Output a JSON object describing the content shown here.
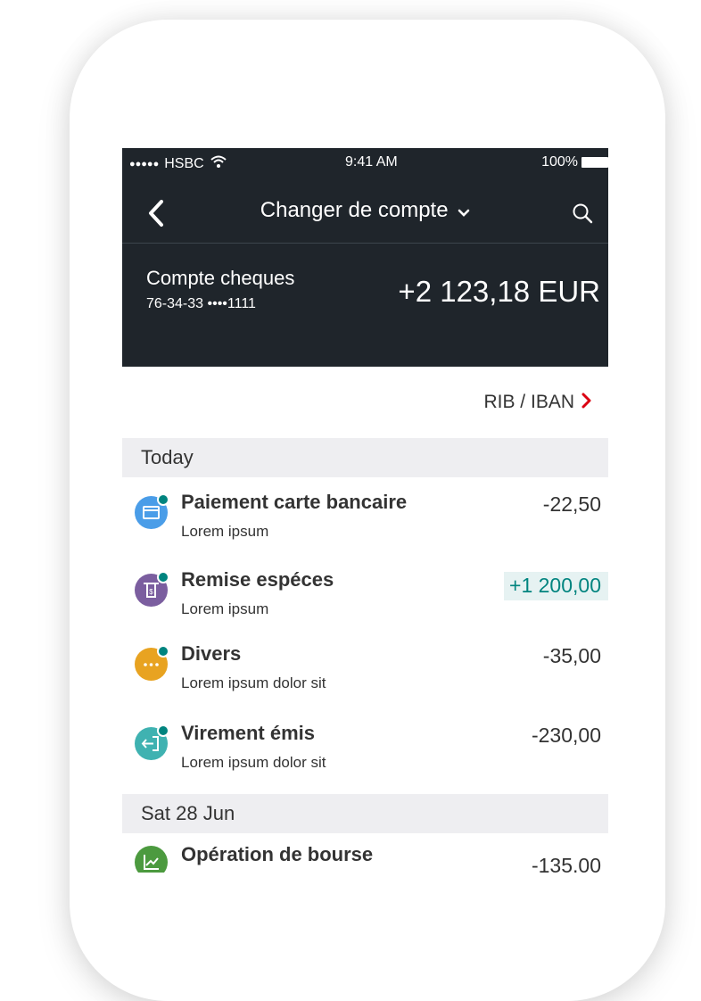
{
  "status_bar": {
    "signal": "●●●●●",
    "carrier": "HSBC",
    "time": "9:41 AM",
    "battery_pct": "100%"
  },
  "nav": {
    "title": "Changer de compte",
    "back_icon": "chevron-left-icon",
    "search_icon": "search-icon"
  },
  "account": {
    "name": "Compte cheques",
    "number": "76-34-33 ••••1111",
    "balance": "+2 123,18 EUR"
  },
  "rib_link": {
    "label": "RIB / IBAN",
    "arrow": "›"
  },
  "sections": [
    {
      "label": "Today",
      "transactions": [
        {
          "title": "Paiement carte bancaire",
          "subtitle": "Lorem ipsum",
          "amount": "-22,50",
          "icon": "card-icon",
          "color": "#4a9de8"
        },
        {
          "title": "Remise espéces",
          "subtitle": "Lorem ipsum",
          "amount": "+1 200,00",
          "icon": "cash-deposit-icon",
          "color": "#7b5e9f"
        },
        {
          "title": "Divers",
          "subtitle": "Lorem ipsum dolor sit",
          "amount": "-35,00",
          "icon": "more-icon",
          "color": "#e8a321"
        },
        {
          "title": "Virement émis",
          "subtitle": "Lorem ipsum dolor sit",
          "amount": "-230,00",
          "icon": "transfer-out-icon",
          "color": "#3fb2b1"
        }
      ]
    },
    {
      "label": "Sat 28 Jun",
      "transactions": [
        {
          "title": "Opération de bourse",
          "subtitle": "",
          "amount": "-135,00",
          "icon": "stock-chart-icon",
          "color": "#4c9a3f"
        }
      ]
    }
  ],
  "colors": {
    "header_bg": "#1f252b",
    "accent_red": "#db0011",
    "positive_green": "#00847f",
    "section_bg": "#eeeef1"
  }
}
